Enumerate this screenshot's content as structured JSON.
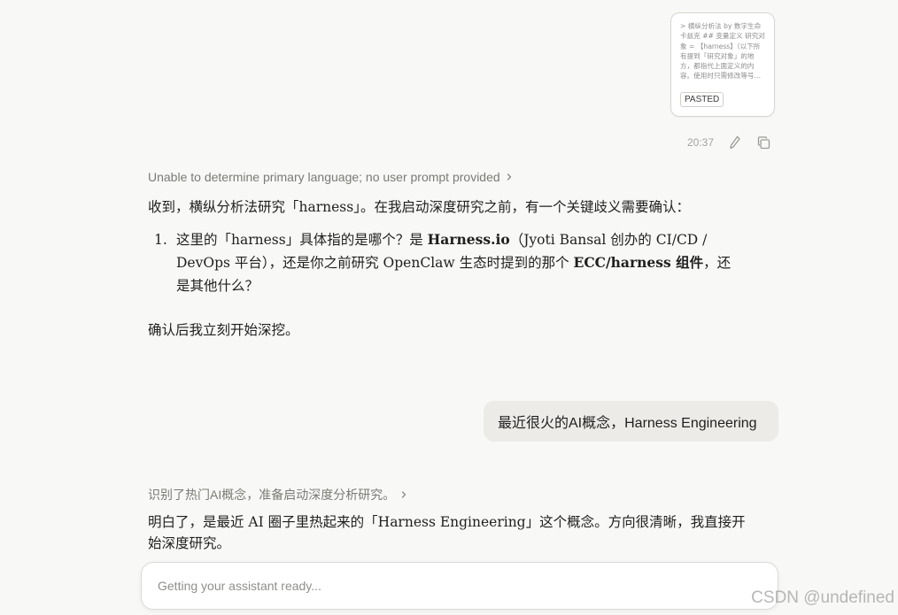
{
  "pasted_card": {
    "preview": "> 横纵分析法 by 数字生命卡兹克 ## 变量定义 研究对象 = 【harness】（以下所有提到「研究对象」的地方，都指代上面定义的内容。使用时只需修改等号…",
    "badge": "PASTED"
  },
  "message_meta": {
    "time": "20:37",
    "icons": [
      "pencil-icon",
      "copy-icon"
    ]
  },
  "assistant_1": {
    "thinking": "Unable to determine primary language; no user prompt provided",
    "intro": "收到，横纵分析法研究「harness」。在我启动深度研究之前，有一个关键歧义需要确认：",
    "list": [
      {
        "number": "1.",
        "part1": "这里的「harness」具体指的是哪个？是 ",
        "bold1": "Harness.io",
        "part2": "（Jyoti Bansal 创办的 CI/CD / DevOps 平台），还是你之前研究 OpenClaw 生态时提到的那个 ",
        "bold2": "ECC/harness 组件",
        "part3": "，还是其他什么？"
      }
    ],
    "closing": "确认后我立刻开始深挖。"
  },
  "user_message": {
    "text": "最近很火的AI概念，Harness Engineering"
  },
  "assistant_2": {
    "thinking": "识别了热门AI概念，准备启动深度分析研究。",
    "text": "明白了，是最近 AI 圈子里热起来的「Harness Engineering」这个概念。方向很清晰，我直接开始深度研究。"
  },
  "composer": {
    "placeholder": "Getting your assistant ready..."
  },
  "watermark": "CSDN @undefined"
}
